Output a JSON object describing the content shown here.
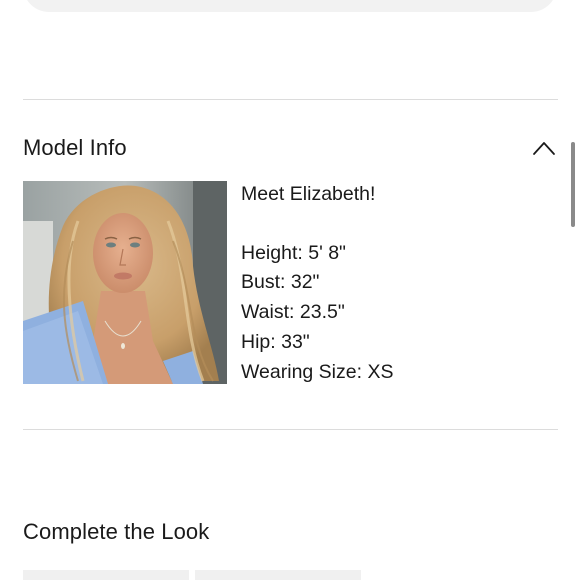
{
  "model_info": {
    "title": "Model Info",
    "toggle_icon": "chevron-up-icon",
    "photo_alt": "Model Elizabeth",
    "intro": "Meet Elizabeth!",
    "stats": [
      {
        "label": "Height:",
        "value": "5' 8\""
      },
      {
        "label": "Bust:",
        "value": "32\""
      },
      {
        "label": "Waist:",
        "value": "23.5\""
      },
      {
        "label": "Hip:",
        "value": "33\""
      },
      {
        "label": "Wearing Size:",
        "value": "XS"
      }
    ]
  },
  "complete_the_look": {
    "title": "Complete the Look"
  },
  "colors": {
    "divider": "#dcdcdc",
    "text": "#1a1a1a",
    "pill": "#f2f2f2"
  }
}
